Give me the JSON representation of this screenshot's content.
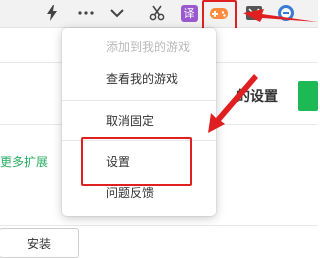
{
  "toolbar": {
    "icons": [
      "lightning-icon",
      "more-dots-icon",
      "chevron-down-icon",
      "scissors-icon",
      "translate-icon",
      "game-controller-icon",
      "reader-icon",
      "extension-icon"
    ],
    "translate_label": "译",
    "colors": {
      "translate_bg": "#9b59d0",
      "game_bg": "#ff8a3d",
      "highlight": "#e02020"
    }
  },
  "page": {
    "settings_heading": "的设置",
    "more_extensions_link": "更多扩展",
    "install_button": "安装"
  },
  "menu": {
    "items": [
      {
        "label": "添加到我的游戏",
        "enabled": false
      },
      {
        "label": "查看我的游戏",
        "enabled": true
      },
      {
        "label": "取消固定",
        "enabled": true
      },
      {
        "label": "设置",
        "enabled": true,
        "highlighted": true
      },
      {
        "label": "问题反馈",
        "enabled": true
      }
    ]
  }
}
